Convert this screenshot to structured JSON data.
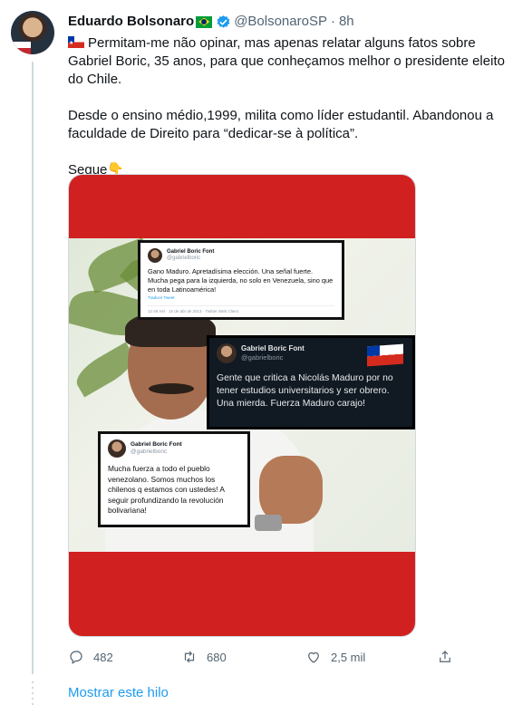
{
  "tweet": {
    "author_name": "Eduardo Bolsonaro",
    "author_handle": "@BolsonaroSP",
    "separator": "·",
    "time": "8h",
    "paragraphs": [
      "Permitam-me não opinar, mas apenas relatar alguns fatos sobre Gabriel Boric, 35 anos, para que conheçamos melhor o presidente eleito do Chile.",
      "Desde o ensino médio,1999, milita como líder estudantil. Abandonou a faculdade de Direito para “dedicar-se à política”.",
      "Segue"
    ],
    "emoji_point": "👇"
  },
  "image": {
    "card1": {
      "name": "Gabriel Boric Font",
      "handle": "@gabrielboric",
      "text": "Gano Maduro. Apretadísima elección. Una señal fuerte. Mucha pega para la izquierda, no solo en Venezuela, sino que en toda Latinoamérica!",
      "translate": "Traducir Tweet",
      "meta": "12:48 AM · 15 de abr de 2013 · Twitter Web Client"
    },
    "card2": {
      "name": "Gabriel Boric Font",
      "handle": "@gabrielboric",
      "text": "Gente que critica a Nicolás Maduro por no tener estudios universitarios y ser obrero. Una mierda. Fuerza Maduro carajo!"
    },
    "card3": {
      "name": "Gabriel Boric Font",
      "handle": "@gabrielboric",
      "text": "Mucha fuerza a todo el pueblo venezolano. Somos muchos los chilenos q estamos con ustedes! A seguir profundizando la revolución bolivariana!"
    }
  },
  "actions": {
    "replies": "482",
    "retweets": "680",
    "likes": "2,5 mil"
  },
  "show_thread": "Mostrar este hilo",
  "colors": {
    "accent": "#1d9bf0",
    "muted": "#536471",
    "banner_red": "#d12020"
  }
}
